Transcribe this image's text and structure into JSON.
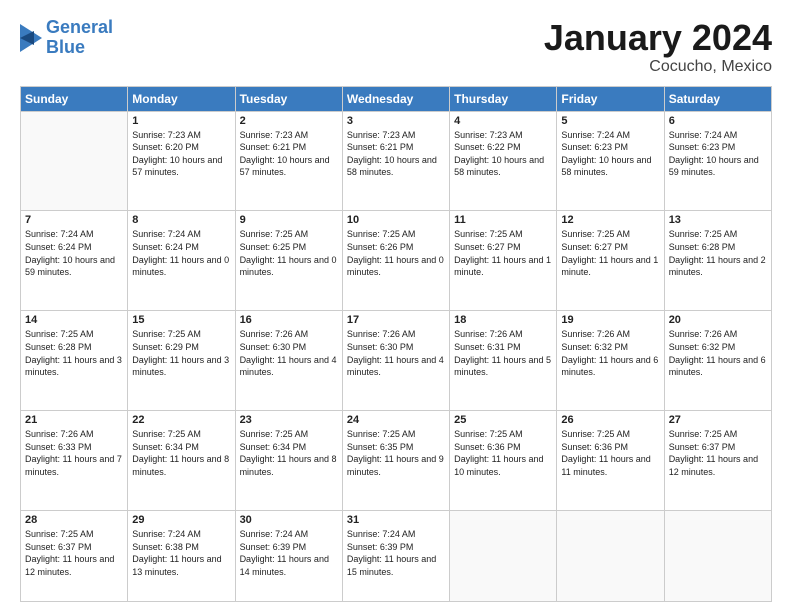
{
  "logo": {
    "line1": "General",
    "line2": "Blue"
  },
  "title": "January 2024",
  "subtitle": "Cocucho, Mexico",
  "days_of_week": [
    "Sunday",
    "Monday",
    "Tuesday",
    "Wednesday",
    "Thursday",
    "Friday",
    "Saturday"
  ],
  "weeks": [
    [
      {
        "day": "",
        "info": ""
      },
      {
        "day": "1",
        "info": "Sunrise: 7:23 AM\nSunset: 6:20 PM\nDaylight: 10 hours and 57 minutes."
      },
      {
        "day": "2",
        "info": "Sunrise: 7:23 AM\nSunset: 6:21 PM\nDaylight: 10 hours and 57 minutes."
      },
      {
        "day": "3",
        "info": "Sunrise: 7:23 AM\nSunset: 6:21 PM\nDaylight: 10 hours and 58 minutes."
      },
      {
        "day": "4",
        "info": "Sunrise: 7:23 AM\nSunset: 6:22 PM\nDaylight: 10 hours and 58 minutes."
      },
      {
        "day": "5",
        "info": "Sunrise: 7:24 AM\nSunset: 6:23 PM\nDaylight: 10 hours and 58 minutes."
      },
      {
        "day": "6",
        "info": "Sunrise: 7:24 AM\nSunset: 6:23 PM\nDaylight: 10 hours and 59 minutes."
      }
    ],
    [
      {
        "day": "7",
        "info": "Sunrise: 7:24 AM\nSunset: 6:24 PM\nDaylight: 10 hours and 59 minutes."
      },
      {
        "day": "8",
        "info": "Sunrise: 7:24 AM\nSunset: 6:24 PM\nDaylight: 11 hours and 0 minutes."
      },
      {
        "day": "9",
        "info": "Sunrise: 7:25 AM\nSunset: 6:25 PM\nDaylight: 11 hours and 0 minutes."
      },
      {
        "day": "10",
        "info": "Sunrise: 7:25 AM\nSunset: 6:26 PM\nDaylight: 11 hours and 0 minutes."
      },
      {
        "day": "11",
        "info": "Sunrise: 7:25 AM\nSunset: 6:27 PM\nDaylight: 11 hours and 1 minute."
      },
      {
        "day": "12",
        "info": "Sunrise: 7:25 AM\nSunset: 6:27 PM\nDaylight: 11 hours and 1 minute."
      },
      {
        "day": "13",
        "info": "Sunrise: 7:25 AM\nSunset: 6:28 PM\nDaylight: 11 hours and 2 minutes."
      }
    ],
    [
      {
        "day": "14",
        "info": "Sunrise: 7:25 AM\nSunset: 6:28 PM\nDaylight: 11 hours and 3 minutes."
      },
      {
        "day": "15",
        "info": "Sunrise: 7:25 AM\nSunset: 6:29 PM\nDaylight: 11 hours and 3 minutes."
      },
      {
        "day": "16",
        "info": "Sunrise: 7:26 AM\nSunset: 6:30 PM\nDaylight: 11 hours and 4 minutes."
      },
      {
        "day": "17",
        "info": "Sunrise: 7:26 AM\nSunset: 6:30 PM\nDaylight: 11 hours and 4 minutes."
      },
      {
        "day": "18",
        "info": "Sunrise: 7:26 AM\nSunset: 6:31 PM\nDaylight: 11 hours and 5 minutes."
      },
      {
        "day": "19",
        "info": "Sunrise: 7:26 AM\nSunset: 6:32 PM\nDaylight: 11 hours and 6 minutes."
      },
      {
        "day": "20",
        "info": "Sunrise: 7:26 AM\nSunset: 6:32 PM\nDaylight: 11 hours and 6 minutes."
      }
    ],
    [
      {
        "day": "21",
        "info": "Sunrise: 7:26 AM\nSunset: 6:33 PM\nDaylight: 11 hours and 7 minutes."
      },
      {
        "day": "22",
        "info": "Sunrise: 7:25 AM\nSunset: 6:34 PM\nDaylight: 11 hours and 8 minutes."
      },
      {
        "day": "23",
        "info": "Sunrise: 7:25 AM\nSunset: 6:34 PM\nDaylight: 11 hours and 8 minutes."
      },
      {
        "day": "24",
        "info": "Sunrise: 7:25 AM\nSunset: 6:35 PM\nDaylight: 11 hours and 9 minutes."
      },
      {
        "day": "25",
        "info": "Sunrise: 7:25 AM\nSunset: 6:36 PM\nDaylight: 11 hours and 10 minutes."
      },
      {
        "day": "26",
        "info": "Sunrise: 7:25 AM\nSunset: 6:36 PM\nDaylight: 11 hours and 11 minutes."
      },
      {
        "day": "27",
        "info": "Sunrise: 7:25 AM\nSunset: 6:37 PM\nDaylight: 11 hours and 12 minutes."
      }
    ],
    [
      {
        "day": "28",
        "info": "Sunrise: 7:25 AM\nSunset: 6:37 PM\nDaylight: 11 hours and 12 minutes."
      },
      {
        "day": "29",
        "info": "Sunrise: 7:24 AM\nSunset: 6:38 PM\nDaylight: 11 hours and 13 minutes."
      },
      {
        "day": "30",
        "info": "Sunrise: 7:24 AM\nSunset: 6:39 PM\nDaylight: 11 hours and 14 minutes."
      },
      {
        "day": "31",
        "info": "Sunrise: 7:24 AM\nSunset: 6:39 PM\nDaylight: 11 hours and 15 minutes."
      },
      {
        "day": "",
        "info": ""
      },
      {
        "day": "",
        "info": ""
      },
      {
        "day": "",
        "info": ""
      }
    ]
  ]
}
